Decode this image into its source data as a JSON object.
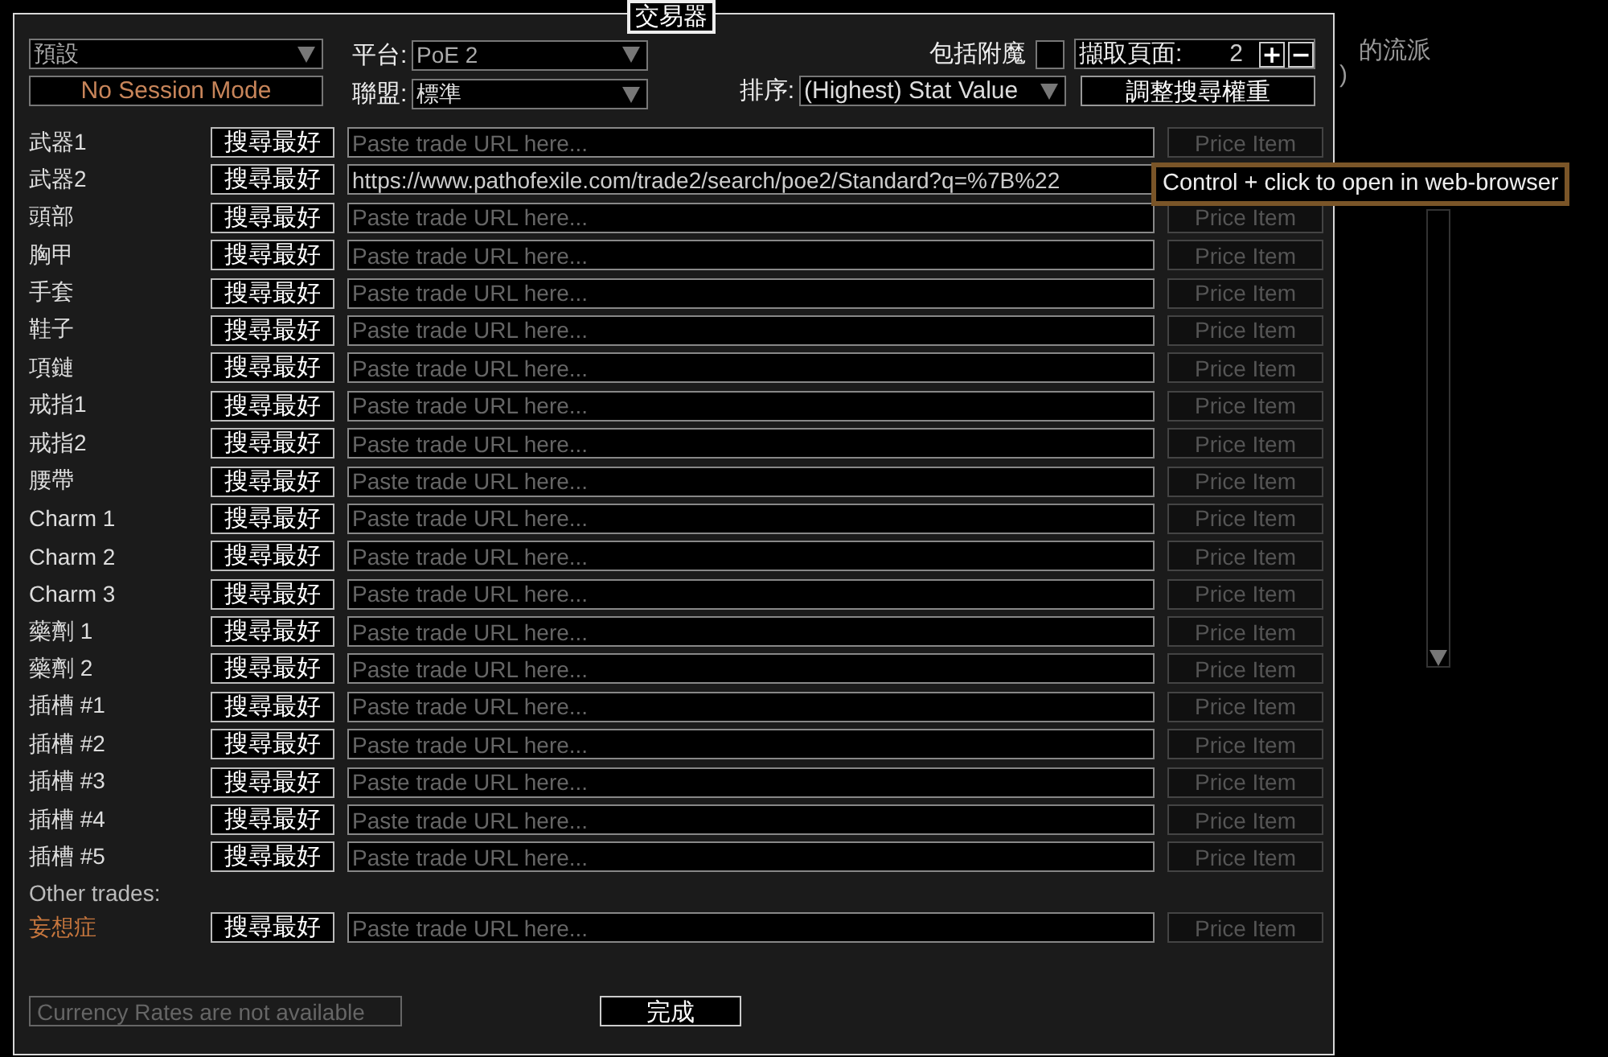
{
  "background": {
    "texts": [
      "的流派",
      ")"
    ]
  },
  "dialog": {
    "title": "交易器",
    "preset": {
      "value": "預設"
    },
    "session_mode": "No Session Mode",
    "platform": {
      "label": "平台:",
      "value": "PoE 2"
    },
    "league": {
      "label": "聯盟:",
      "value": "標準"
    },
    "include_enchants": {
      "label": "包括附魔",
      "checked": false
    },
    "fetch_pages": {
      "label": "擷取頁面:",
      "value": "2",
      "plus": "+",
      "minus": "−"
    },
    "sort": {
      "label": "排序:",
      "value": "(Highest) Stat Value"
    },
    "adjust_weights": "調整搜尋權重",
    "slots": [
      {
        "name": "武器1",
        "search": "搜尋最好",
        "placeholder": "Paste trade URL here...",
        "price": "Price Item",
        "price_disabled": true
      },
      {
        "name": "武器2",
        "search": "搜尋最好",
        "url": "https://www.pathofexile.com/trade2/search/poe2/Standard?q=%7B%22"
      },
      {
        "name": "頭部",
        "search": "搜尋最好",
        "placeholder": "Paste trade URL here...",
        "price": "Price Item",
        "price_disabled": true
      },
      {
        "name": "胸甲",
        "search": "搜尋最好",
        "placeholder": "Paste trade URL here...",
        "price": "Price Item",
        "price_disabled": true
      },
      {
        "name": "手套",
        "search": "搜尋最好",
        "placeholder": "Paste trade URL here...",
        "price": "Price Item",
        "price_disabled": true
      },
      {
        "name": "鞋子",
        "search": "搜尋最好",
        "placeholder": "Paste trade URL here...",
        "price": "Price Item",
        "price_disabled": true
      },
      {
        "name": "項鏈",
        "search": "搜尋最好",
        "placeholder": "Paste trade URL here...",
        "price": "Price Item",
        "price_disabled": true
      },
      {
        "name": "戒指1",
        "search": "搜尋最好",
        "placeholder": "Paste trade URL here...",
        "price": "Price Item",
        "price_disabled": true
      },
      {
        "name": "戒指2",
        "search": "搜尋最好",
        "placeholder": "Paste trade URL here...",
        "price": "Price Item",
        "price_disabled": true
      },
      {
        "name": "腰帶",
        "search": "搜尋最好",
        "placeholder": "Paste trade URL here...",
        "price": "Price Item",
        "price_disabled": true
      },
      {
        "name": "Charm 1",
        "search": "搜尋最好",
        "placeholder": "Paste trade URL here...",
        "price": "Price Item",
        "price_disabled": true
      },
      {
        "name": "Charm 2",
        "search": "搜尋最好",
        "placeholder": "Paste trade URL here...",
        "price": "Price Item",
        "price_disabled": true
      },
      {
        "name": "Charm 3",
        "search": "搜尋最好",
        "placeholder": "Paste trade URL here...",
        "price": "Price Item",
        "price_disabled": true
      },
      {
        "name": "藥劑 1",
        "search": "搜尋最好",
        "placeholder": "Paste trade URL here...",
        "price": "Price Item",
        "price_disabled": true
      },
      {
        "name": "藥劑 2",
        "search": "搜尋最好",
        "placeholder": "Paste trade URL here...",
        "price": "Price Item",
        "price_disabled": true
      },
      {
        "name": "插槽 #1",
        "search": "搜尋最好",
        "placeholder": "Paste trade URL here...",
        "price": "Price Item",
        "price_disabled": true
      },
      {
        "name": "插槽 #2",
        "search": "搜尋最好",
        "placeholder": "Paste trade URL here...",
        "price": "Price Item",
        "price_disabled": true
      },
      {
        "name": "插槽 #3",
        "search": "搜尋最好",
        "placeholder": "Paste trade URL here...",
        "price": "Price Item",
        "price_disabled": true
      },
      {
        "name": "插槽 #4",
        "search": "搜尋最好",
        "placeholder": "Paste trade URL here...",
        "price": "Price Item",
        "price_disabled": true
      },
      {
        "name": "插槽 #5",
        "search": "搜尋最好",
        "placeholder": "Paste trade URL here...",
        "price": "Price Item",
        "price_disabled": true
      }
    ],
    "other_trades_label": "Other trades:",
    "other_slots": [
      {
        "name": "妄想症",
        "color": "#c8773e",
        "search": "搜尋最好",
        "placeholder": "Paste trade URL here...",
        "price": "Price Item",
        "price_disabled": true
      }
    ],
    "currency_status": "Currency Rates are not available",
    "done": "完成"
  },
  "tooltip": "Control + click to open in web-browser"
}
